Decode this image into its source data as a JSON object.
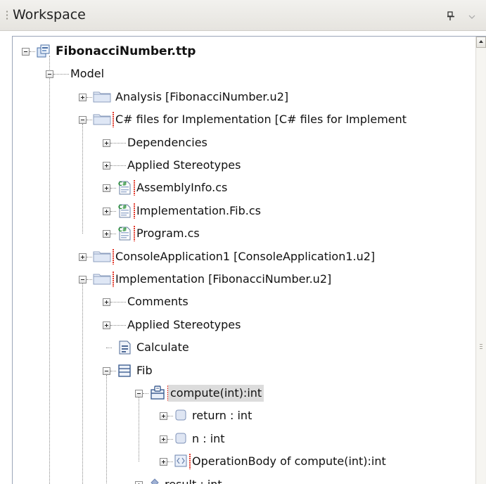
{
  "window": {
    "title": "Workspace",
    "pin_glyph": "ⅎ",
    "menu_glyph": "▼"
  },
  "tree": [
    {
      "id": "project",
      "label": "FibonacciNumber.ttp",
      "level": 0,
      "expander": "minus",
      "icon": "project-icon",
      "bold": true
    },
    {
      "id": "model",
      "label": "Model",
      "level": 1,
      "expander": "minus",
      "icon": "none"
    },
    {
      "id": "analysis",
      "label": "Analysis [FibonacciNumber.u2]",
      "level": 2,
      "expander": "plus",
      "icon": "folder-icon"
    },
    {
      "id": "csharp-files",
      "label": "C# files for Implementation [C# files for Implement",
      "level": 2,
      "expander": "minus",
      "icon": "folder-icon",
      "redmark": true
    },
    {
      "id": "dependencies",
      "label": "Dependencies",
      "level": 3,
      "expander": "plus",
      "icon": "none"
    },
    {
      "id": "applied-stereotypes-1",
      "label": "Applied Stereotypes",
      "level": 3,
      "expander": "plus",
      "icon": "none"
    },
    {
      "id": "assemblyinfo",
      "label": "AssemblyInfo.cs",
      "level": 3,
      "expander": "plus",
      "icon": "csharp-file-icon",
      "redmark": true
    },
    {
      "id": "implementation-fib",
      "label": "Implementation.Fib.cs",
      "level": 3,
      "expander": "plus",
      "icon": "csharp-file-icon",
      "redmark": true
    },
    {
      "id": "program",
      "label": "Program.cs",
      "level": 3,
      "expander": "plus",
      "icon": "csharp-file-icon",
      "redmark": true
    },
    {
      "id": "consoleapp",
      "label": "ConsoleApplication1 [ConsoleApplication1.u2]",
      "level": 2,
      "expander": "plus",
      "icon": "folder-icon",
      "redmark": true
    },
    {
      "id": "implementation",
      "label": "Implementation [FibonacciNumber.u2]",
      "level": 2,
      "expander": "minus",
      "icon": "folder-icon",
      "redmark": true
    },
    {
      "id": "comments",
      "label": "Comments",
      "level": 3,
      "expander": "plus",
      "icon": "none"
    },
    {
      "id": "applied-stereotypes-2",
      "label": "Applied Stereotypes",
      "level": 3,
      "expander": "plus",
      "icon": "none"
    },
    {
      "id": "calculate",
      "label": "Calculate",
      "level": 3,
      "expander": "none",
      "icon": "document-icon"
    },
    {
      "id": "fib",
      "label": "Fib",
      "level": 3,
      "expander": "minus",
      "icon": "class-icon"
    },
    {
      "id": "compute",
      "label": "compute(int):int",
      "level": 4,
      "expander": "minus",
      "icon": "operation-icon",
      "redmark": true,
      "selected": true
    },
    {
      "id": "return",
      "label": "return  : int",
      "level": 5,
      "expander": "plus",
      "icon": "parameter-icon"
    },
    {
      "id": "n",
      "label": "n : int",
      "level": 5,
      "expander": "plus",
      "icon": "parameter-icon"
    },
    {
      "id": "operationbody",
      "label": "OperationBody of compute(int):int",
      "level": 5,
      "expander": "plus",
      "icon": "method-body-icon",
      "redmark": true
    },
    {
      "id": "result",
      "label": "result : int",
      "level": 4,
      "expander": "plus",
      "icon": "attribute-icon"
    }
  ]
}
